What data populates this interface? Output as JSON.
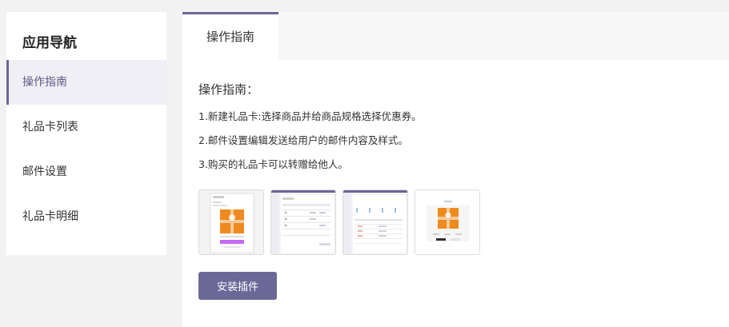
{
  "sidebar": {
    "title": "应用导航",
    "items": [
      {
        "label": "操作指南"
      },
      {
        "label": "礼品卡列表"
      },
      {
        "label": "邮件设置"
      },
      {
        "label": "礼品卡明细"
      }
    ]
  },
  "main": {
    "tabs": [
      {
        "label": "操作指南"
      }
    ],
    "guide_title": "操作指南：",
    "steps": [
      "1.新建礼品卡:选择商品并给商品规格选择优惠券。",
      "2.邮件设置编辑发送给用户的邮件内容及样式。",
      "3.购买的礼品卡可以转赠给他人。"
    ],
    "install_button": "安装插件"
  },
  "colors": {
    "accent": "#6b6797",
    "active_bg": "#f0eff5",
    "page_bg": "#f2f2f2",
    "gift_orange": "#ef8a1f"
  }
}
